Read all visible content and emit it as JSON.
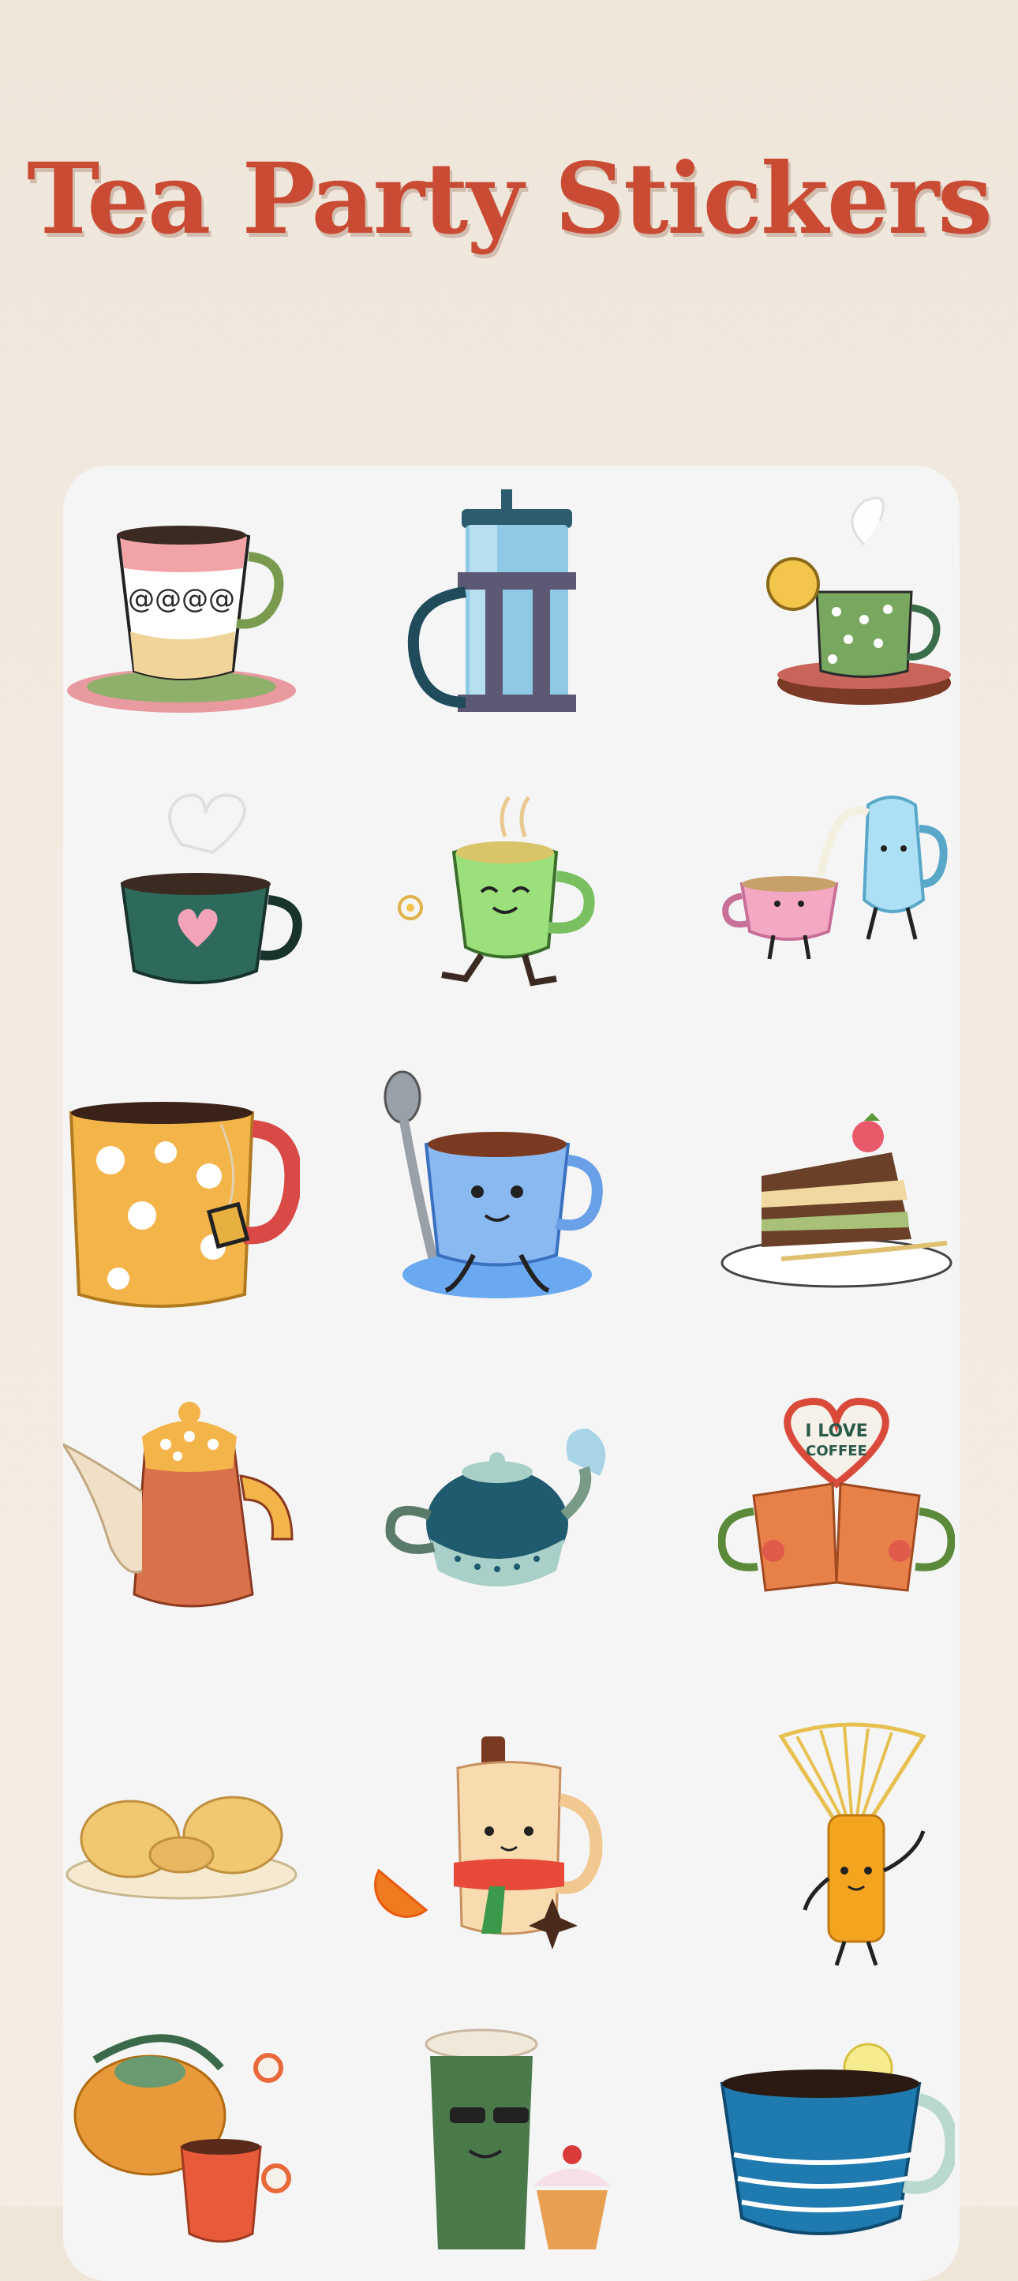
{
  "page": {
    "title": "Tea Party Stickers"
  },
  "stickers": [
    {
      "name": "floral-teacup-icon"
    },
    {
      "name": "french-press-icon"
    },
    {
      "name": "lemon-tea-cup-icon"
    },
    {
      "name": "heart-mug-icon"
    },
    {
      "name": "daisy-cup-character-icon"
    },
    {
      "name": "cup-and-milk-jug-icon"
    },
    {
      "name": "teabag-mug-icon"
    },
    {
      "name": "spoon-cup-character-icon"
    },
    {
      "name": "cake-slice-icon"
    },
    {
      "name": "coffee-pot-icon"
    },
    {
      "name": "teapot-icon"
    },
    {
      "name": "i-love-coffee-mugs-icon",
      "text": [
        "I LOVE",
        "COFFEE"
      ]
    },
    {
      "name": "cookies-plate-icon"
    },
    {
      "name": "cinnamon-mug-character-icon"
    },
    {
      "name": "matcha-whisk-character-icon"
    },
    {
      "name": "kettle-and-cup-icon"
    },
    {
      "name": "coffee-cup-cupcake-icon"
    },
    {
      "name": "lemon-teacup-icon"
    }
  ],
  "colors": {
    "title": "#c94b33",
    "panel": "#f5f5f6",
    "background": "#efe6da"
  }
}
